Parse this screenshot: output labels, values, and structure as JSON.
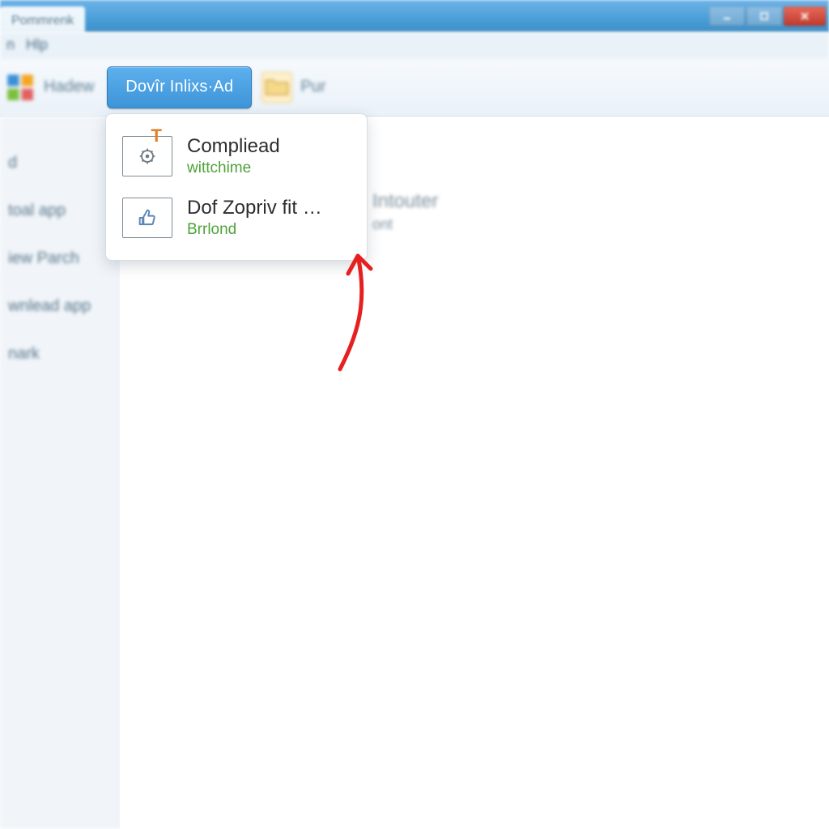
{
  "window": {
    "title_tab": "Pommrenk"
  },
  "menubar": {
    "items": [
      "n",
      "Hlp"
    ]
  },
  "toolbar": {
    "btn_left_label": "Hadew",
    "primary_label": "Dovîr Inlixs·Ad",
    "btn_right_label": "Pur"
  },
  "sidebar": {
    "items": [
      {
        "label": "d"
      },
      {
        "label": "toal app"
      },
      {
        "label": "iew Parch"
      },
      {
        "label": "wnlead app"
      },
      {
        "label": "nark"
      }
    ]
  },
  "dropdown": {
    "items": [
      {
        "title": "Compliead",
        "sub": "wittchime",
        "icon": "gear",
        "badge": "T"
      },
      {
        "title": "Dof Zopriv fit …",
        "sub": "Brrlond",
        "icon": "thumb"
      }
    ]
  },
  "ghost": {
    "line1": "Intouter",
    "line2": "ont"
  },
  "colors": {
    "primary": "#3d94d8",
    "accent_green": "#4fa23a",
    "annotation_red": "#e62020"
  }
}
